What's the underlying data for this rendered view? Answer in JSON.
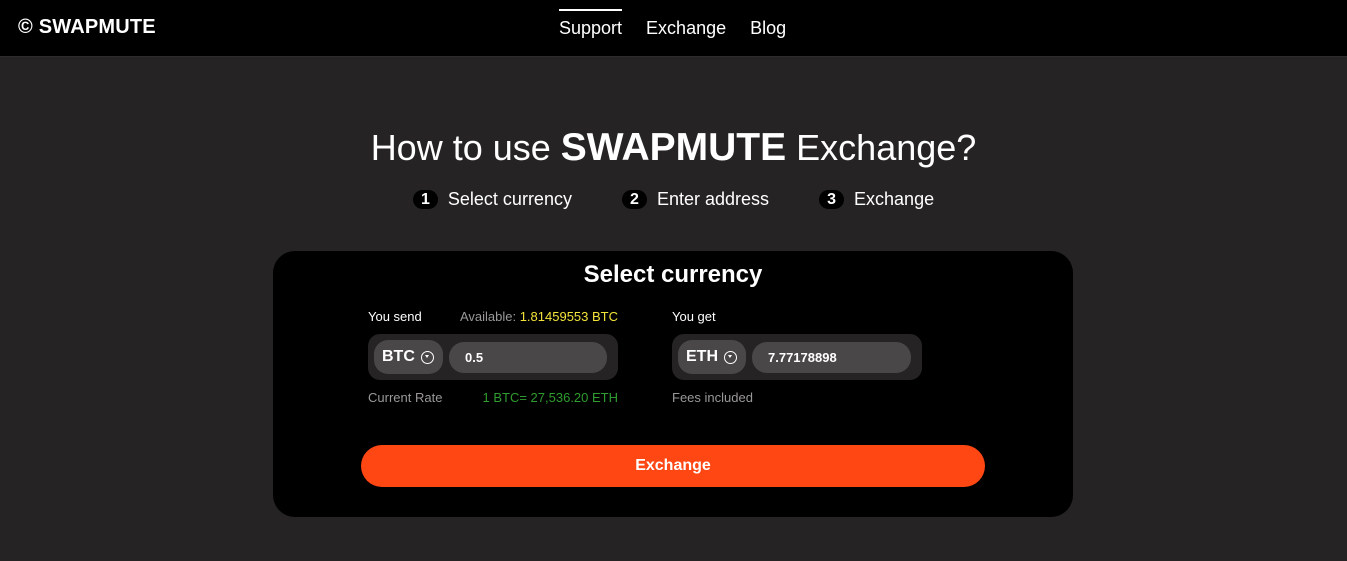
{
  "header": {
    "logo": "© SWAPMUTE",
    "nav": [
      {
        "label": "Support",
        "active": true
      },
      {
        "label": "Exchange",
        "active": false
      },
      {
        "label": "Blog",
        "active": false
      }
    ]
  },
  "hero": {
    "title_pre": "How to use",
    "title_brand": "SWAPMUTE",
    "title_post": "Exchange?"
  },
  "steps": [
    {
      "num": "1",
      "label": "Select currency"
    },
    {
      "num": "2",
      "label": "Enter address"
    },
    {
      "num": "3",
      "label": "Exchange"
    }
  ],
  "card": {
    "title": "Select currency",
    "send": {
      "label": "You send",
      "available_label": "Available:",
      "available_value": "1.81459553 BTC",
      "currency": "BTC",
      "amount": "0.5",
      "rate_label": "Current Rate",
      "rate_value": "1 BTC= 27,536.20 ETH"
    },
    "get": {
      "label": "You get",
      "currency": "ETH",
      "amount": "7.77178898",
      "fees": "Fees included"
    },
    "exchange_button": "Exchange"
  },
  "colors": {
    "accent": "#ff4713",
    "available": "#f2e33a",
    "rate": "#2e9c2e",
    "background": "#252324",
    "panel": "#000000"
  },
  "icons": {
    "dropdown": "chevron-down-circle-icon"
  }
}
